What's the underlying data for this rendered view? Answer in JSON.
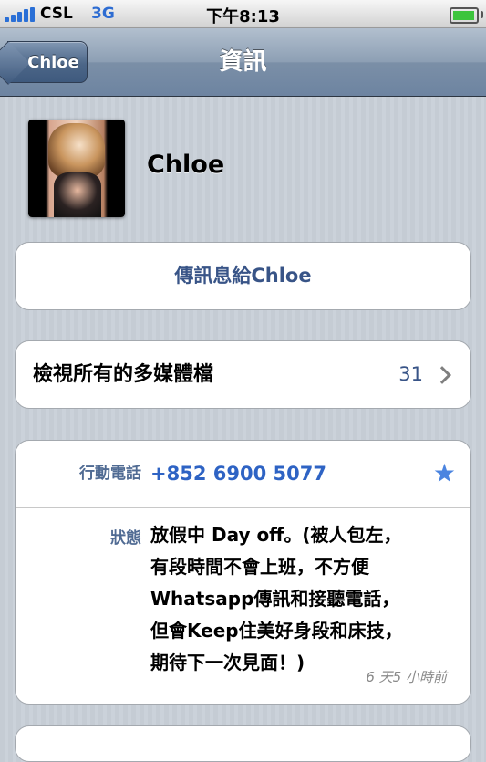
{
  "status_bar": {
    "carrier": "CSL",
    "network": "3G",
    "time": "下午8:13",
    "battery_level": 0.95
  },
  "nav": {
    "back_label": "Chloe",
    "title": "資訊"
  },
  "contact": {
    "name": "Chloe"
  },
  "message_action": {
    "label": "傳訊息給Chloe"
  },
  "media": {
    "label": "檢視所有的多媒體檔",
    "count": "31"
  },
  "info": {
    "phone_label": "行動電話",
    "phone_number": "+852 6900 5077",
    "status_label": "狀態",
    "status_lines": [
      "放假中  Day off。(被人包左，",
      "有段時間不會上班，不方便",
      "Whatsapp傳訊和接聽電話，",
      "但會Keep住美好身段和床技，",
      "期待下一次見面！)"
    ],
    "status_time": "6 天5 小時前"
  },
  "colors": {
    "nav_bar": "#6d84a1",
    "link_blue": "#385487",
    "phone_blue": "#2e63c4",
    "label_blue": "#506b93",
    "background": "#c5ccd4",
    "signal": "#2a6fd6"
  },
  "icons": [
    "signal-icon",
    "battery-icon",
    "back-arrow-icon",
    "chevron-right-icon",
    "star-icon"
  ]
}
